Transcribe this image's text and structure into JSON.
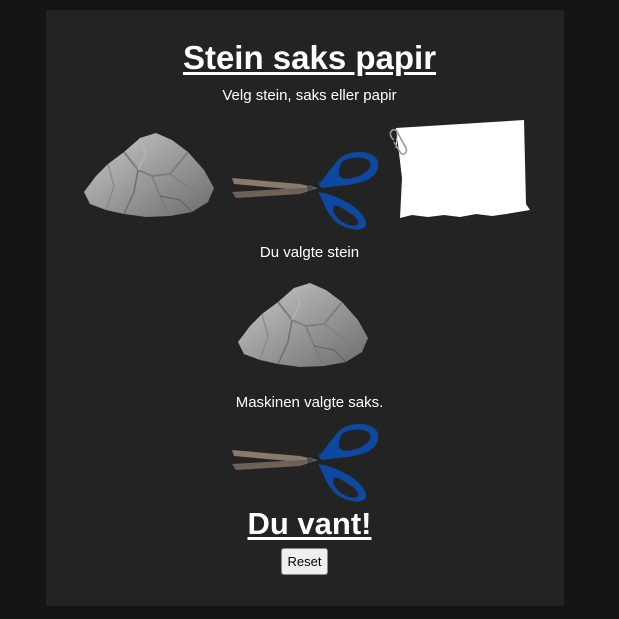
{
  "header": {
    "title": "Stein saks papir",
    "subtitle": "Velg stein, saks eller papir"
  },
  "choices": [
    {
      "id": "stein",
      "icon": "rock-icon"
    },
    {
      "id": "saks",
      "icon": "scissors-icon"
    },
    {
      "id": "papir",
      "icon": "paper-icon"
    }
  ],
  "status": {
    "user_choice_text": "Du valgte stein",
    "machine_choice_text": "Maskinen valgte saks.",
    "result_text": "Du vant!"
  },
  "buttons": {
    "reset_label": "Reset"
  },
  "colors": {
    "page_background": "#141414",
    "panel_background": "#232323",
    "text": "#ffffff",
    "scissors_handle": "#0b4aa0",
    "scissors_blade": "#8a7a6e"
  }
}
